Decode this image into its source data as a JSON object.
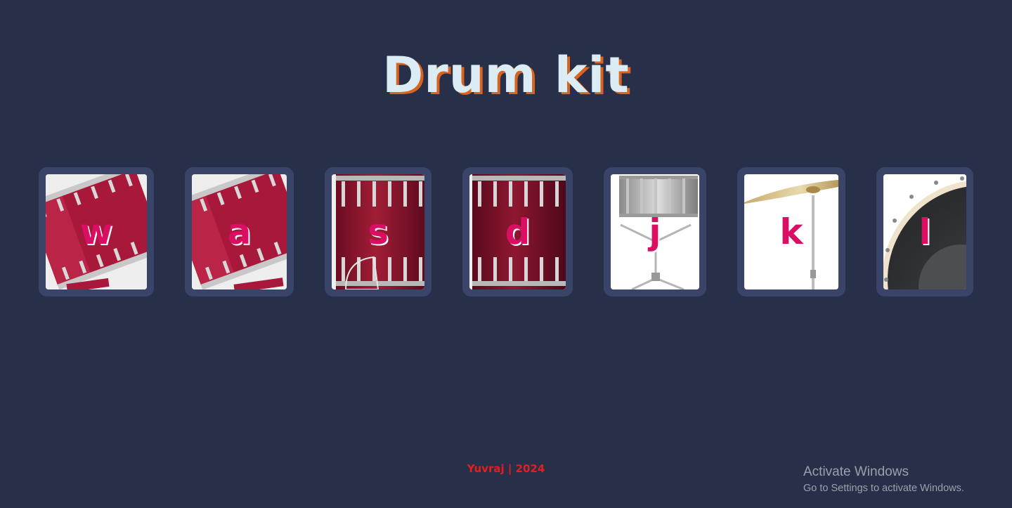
{
  "title": "Drum kit",
  "drums": [
    {
      "key": "w",
      "instrument": "tom-1"
    },
    {
      "key": "a",
      "instrument": "tom-2"
    },
    {
      "key": "s",
      "instrument": "tom-3"
    },
    {
      "key": "d",
      "instrument": "tom-4"
    },
    {
      "key": "j",
      "instrument": "snare"
    },
    {
      "key": "k",
      "instrument": "crash"
    },
    {
      "key": "l",
      "instrument": "kick-bass"
    }
  ],
  "footer": "Yuvraj | 2024",
  "watermark": {
    "line1": "Activate Windows",
    "line2": "Go to Settings to activate Windows."
  },
  "colors": {
    "background": "#283049",
    "card": "#3a4468",
    "key_letter": "#da0f64",
    "title": "#dbecf4",
    "title_shadow": "#d9631f",
    "footer": "#e41e1e"
  }
}
